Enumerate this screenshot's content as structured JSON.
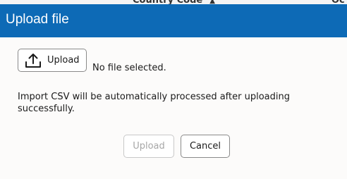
{
  "background": {
    "column_header": "Country Code",
    "column_header_next": "Oc",
    "sort_icon": "sort-arrows-icon"
  },
  "dialog": {
    "title": "Upload file",
    "title_bar_color": "#0d6ab6",
    "file_button_label": "Upload",
    "file_button_icon": "upload-icon",
    "file_status": "No file selected.",
    "info_text": "Import CSV will be automatically processed after uploading successfully.",
    "upload_button_label": "Upload",
    "upload_button_state": "disabled",
    "cancel_button_label": "Cancel"
  }
}
